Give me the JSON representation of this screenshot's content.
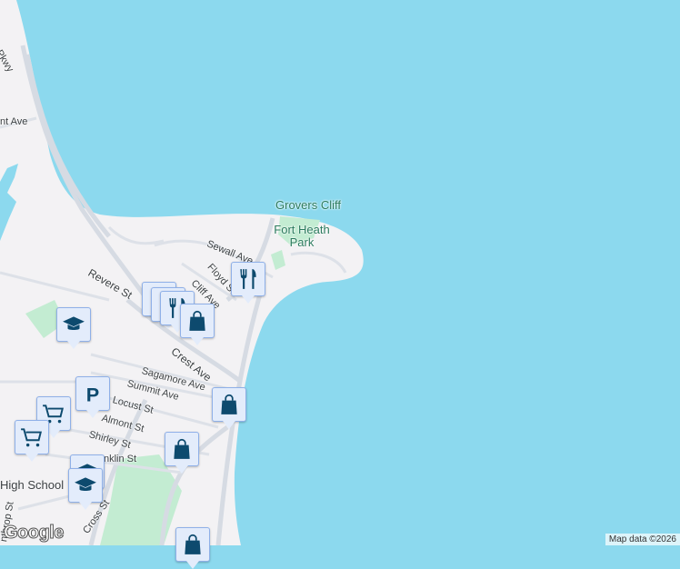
{
  "colors": {
    "water": "#8cd9ee",
    "land": "#f3f2f4",
    "park": "#c3ecd2",
    "road": "#d6dbe3",
    "marker_icon": "#0d4a6e"
  },
  "places": {
    "grovers_cliff": "Grovers Cliff",
    "fort_heath_park": "Fort Heath\nPark",
    "high_school": "High School"
  },
  "streets": {
    "pkwy": "Pkwy",
    "nt_ave": "nt Ave",
    "revere": "Revere St",
    "sewall": "Sewall Ave",
    "floyd": "Floyd St",
    "cliff": "Cliff Ave",
    "crest": "Crest Ave",
    "sagamore": "Sagamore Ave",
    "summit": "Summit Ave",
    "locust": "Locust St",
    "almont": "Almont St",
    "shirley": "Shirley St",
    "franklin": "nklin St",
    "cross": "Cross St",
    "winthrop": "nthrop St",
    "st": "St"
  },
  "markers": [
    {
      "type": "restaurant",
      "icon": "fork-knife-icon"
    },
    {
      "type": "restaurant",
      "icon": "fork-knife-icon"
    },
    {
      "type": "shopping",
      "icon": "shopping-bag-icon"
    },
    {
      "type": "school",
      "icon": "graduation-cap-icon"
    },
    {
      "type": "shopping",
      "icon": "shopping-bag-icon"
    },
    {
      "type": "shopping",
      "icon": "shopping-bag-icon"
    },
    {
      "type": "parking",
      "icon": "parking-icon"
    },
    {
      "type": "grocery",
      "icon": "shopping-cart-icon"
    },
    {
      "type": "grocery",
      "icon": "shopping-cart-icon"
    },
    {
      "type": "school",
      "icon": "graduation-cap-icon"
    },
    {
      "type": "shopping",
      "icon": "shopping-bag-icon"
    }
  ],
  "footer": {
    "logo": "Google",
    "attribution": "Map data ©2026"
  }
}
